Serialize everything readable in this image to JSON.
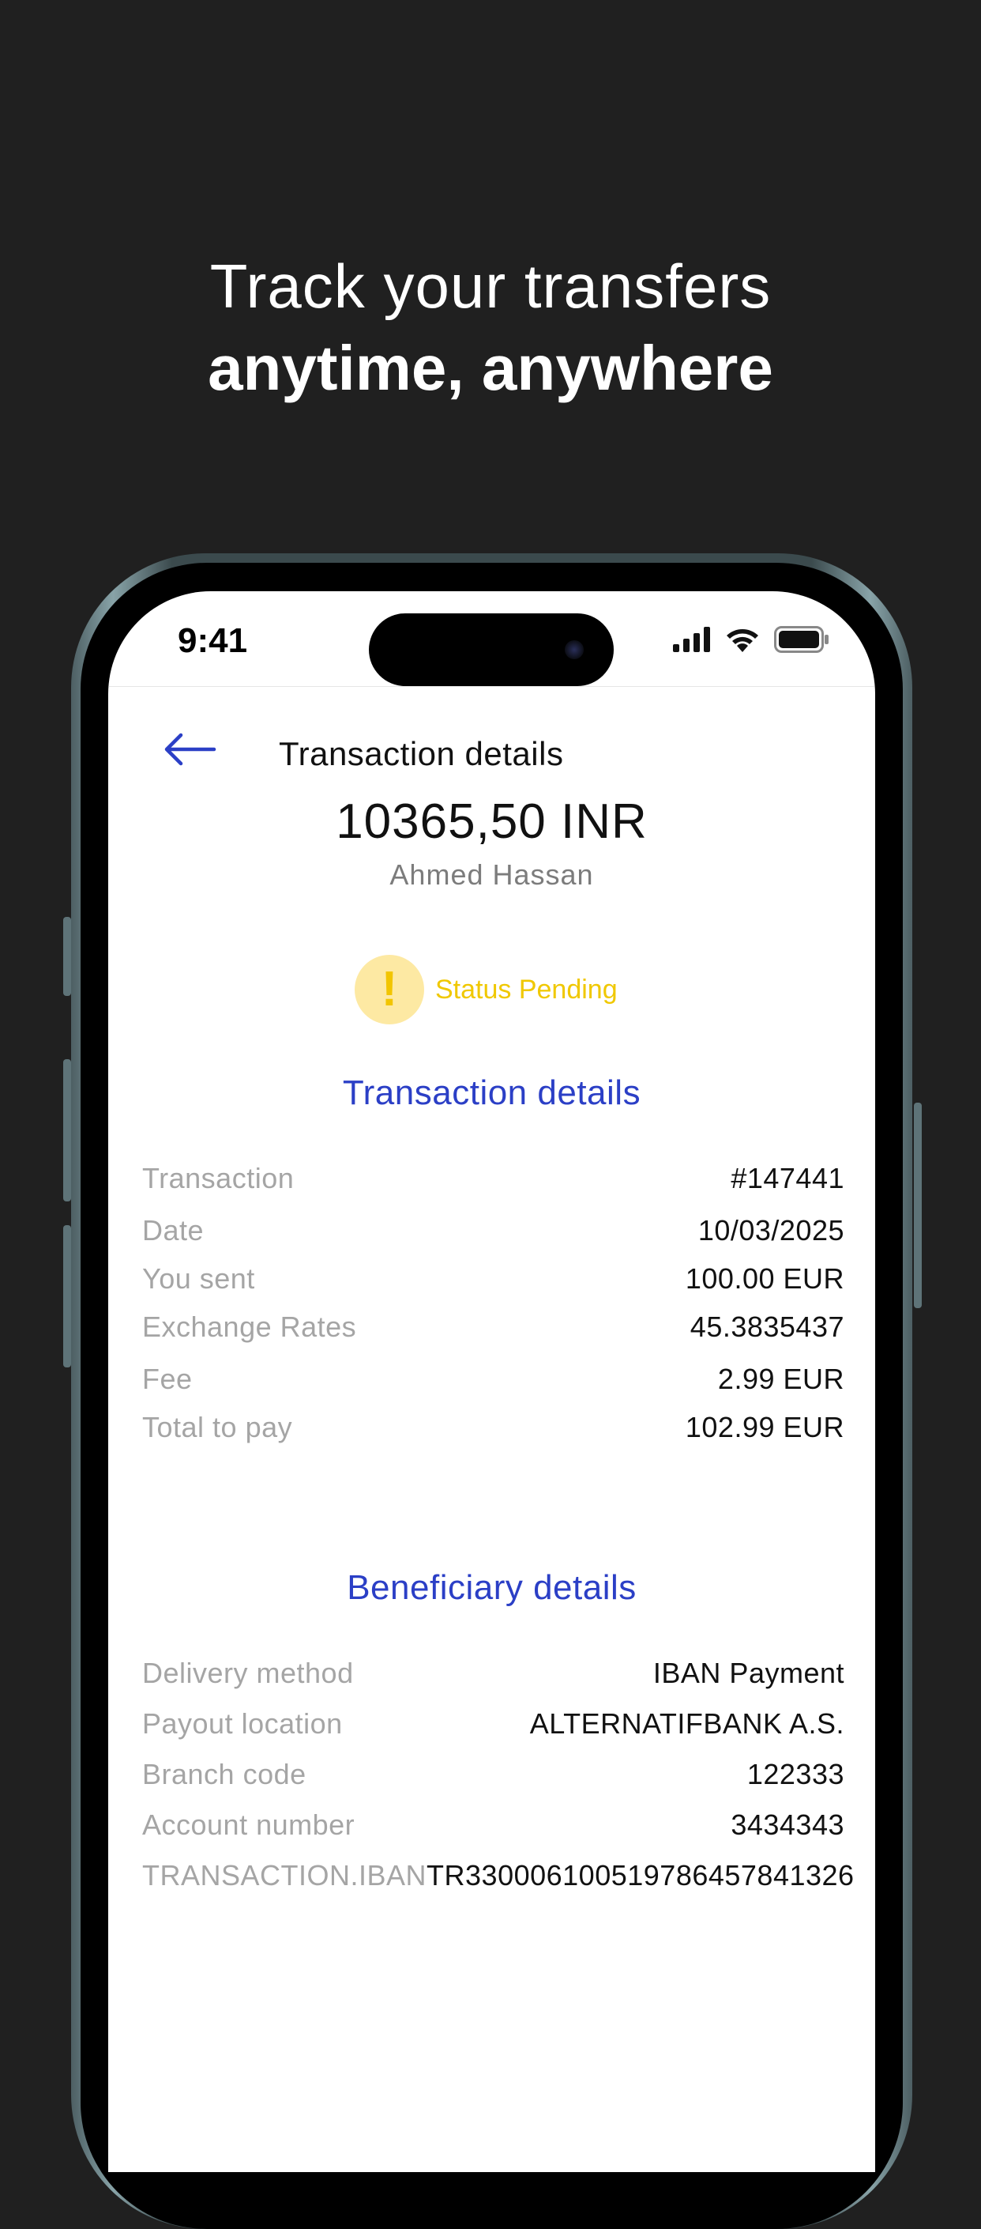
{
  "headline": {
    "line1": "Track your transfers",
    "line2": "anytime, anywhere"
  },
  "status_bar": {
    "time": "9:41",
    "icons": [
      "signal-icon",
      "wifi-icon",
      "battery-icon"
    ]
  },
  "screen": {
    "title": "Transaction details",
    "back_icon": "arrow-left-icon",
    "amount": "10365,50 INR",
    "recipient": "Ahmed Hassan",
    "status_label": "Status Pending",
    "status_icon": "exclamation-icon"
  },
  "transaction_section": {
    "title": "Transaction details",
    "rows": [
      {
        "label": "Transaction",
        "value": "#147441"
      },
      {
        "label": "Date",
        "value": "10/03/2025"
      },
      {
        "label": "You sent",
        "value": "100.00 EUR"
      },
      {
        "label": "Exchange Rates",
        "value": "45.3835437"
      },
      {
        "label": "Fee",
        "value": "2.99 EUR"
      },
      {
        "label": "Total to pay",
        "value": "102.99 EUR"
      }
    ]
  },
  "beneficiary_section": {
    "title": "Beneficiary details",
    "rows": [
      {
        "label": "Delivery method",
        "value": "IBAN Payment"
      },
      {
        "label": "Payout location",
        "value": "ALTERNATIFBANK A.S."
      },
      {
        "label": "Branch code",
        "value": "122333"
      },
      {
        "label": "Account number",
        "value": "3434343"
      },
      {
        "label": "TRANSACTION.IBAN",
        "value": "TR330006100519786457841326"
      }
    ]
  },
  "colors": {
    "background": "#202020",
    "accent_blue": "#2b3fc6",
    "pending_yellow": "#f0c800",
    "pending_bg": "#fde9a3",
    "label_gray": "#a5a5a5"
  }
}
